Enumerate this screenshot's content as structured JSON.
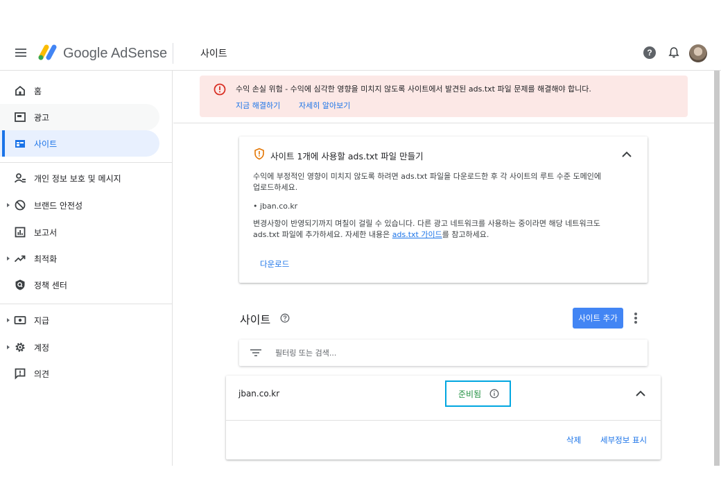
{
  "header": {
    "brand": "Google AdSense",
    "page_title": "사이트",
    "help_glyph": "?"
  },
  "sidebar": {
    "items": [
      {
        "label": "홈",
        "icon": "home-icon"
      },
      {
        "label": "광고",
        "icon": "ads-icon"
      },
      {
        "label": "사이트",
        "icon": "sites-icon",
        "active": true
      },
      {
        "label": "개인 정보 보호 및 메시지",
        "icon": "privacy-icon"
      },
      {
        "label": "브랜드 안전성",
        "icon": "block-icon"
      },
      {
        "label": "보고서",
        "icon": "report-icon"
      },
      {
        "label": "최적화",
        "icon": "trending-icon"
      },
      {
        "label": "정책 센터",
        "icon": "policy-shield-icon"
      },
      {
        "label": "지급",
        "icon": "payment-icon"
      },
      {
        "label": "계정",
        "icon": "gear-icon"
      },
      {
        "label": "의견",
        "icon": "feedback-icon"
      }
    ]
  },
  "alert": {
    "text": "수익 손실 위험 - 수익에 심각한 영향을 미치지 않도록 사이트에서 발견된 ads.txt 파일 문제를 해결해야 합니다.",
    "fix_link": "지금 해결하기",
    "learn_link": "자세히 알아보기"
  },
  "ads_txt_card": {
    "title": "사이트 1개에 사용할 ads.txt 파일 만들기",
    "desc_line1": "수익에 부정적인 영향이 미치지 않도록 하려면 ads.txt 파일을 다운로드한 후 각 사이트의 루트 수준 도메인에",
    "desc_line2": "업로드하세요.",
    "bullet": "• jban.co.kr",
    "note_line1": "변경사항이 반영되기까지 며칠이 걸릴 수 있습니다. 다른 광고 네트워크를 사용하는 중이라면 해당 네트워크도",
    "note_pre": "ads.txt 파일에 추가하세요. 자세한 내용은 ",
    "note_link": "ads.txt 가이드",
    "note_post": "를 참고하세요.",
    "download": "다운로드"
  },
  "sites": {
    "title": "사이트",
    "add_button": "사이트 추가",
    "filter_placeholder": "필터링 또는 검색...",
    "rows": [
      {
        "domain": "jban.co.kr",
        "status": "준비됨",
        "delete": "삭제",
        "details": "세부정보 표시"
      }
    ]
  },
  "colors": {
    "accent": "#1a73e8",
    "alert_bg": "#fce8e6",
    "alert_red": "#d93025",
    "ready_green": "#1e8e3e",
    "highlight_box": "#00a6e0",
    "warning_orange": "#e37400"
  }
}
